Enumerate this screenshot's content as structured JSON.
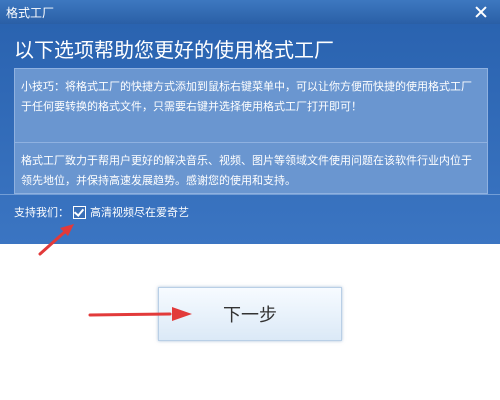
{
  "window": {
    "title": "格式工厂"
  },
  "heading": "以下选项帮助您更好的使用格式工厂",
  "tip": "小技巧：将格式工厂的快捷方式添加到鼠标右键菜单中，可以让你方便而快捷的使用格式工厂于任何要转换的格式文件，只需要右键并选择使用格式工厂打开即可！",
  "info": "格式工厂致力于帮用户更好的解决音乐、视频、图片等领域文件使用问题在该软件行业内位于领先地位，并保持高速发展趋势。感谢您的使用和支持。",
  "support": {
    "label": "支持我们：",
    "option": "高清视频尽在爱奇艺",
    "checked": true
  },
  "next_button": "下一步",
  "colors": {
    "accent": "#2a63b0",
    "arrow": "#e23a3a"
  }
}
